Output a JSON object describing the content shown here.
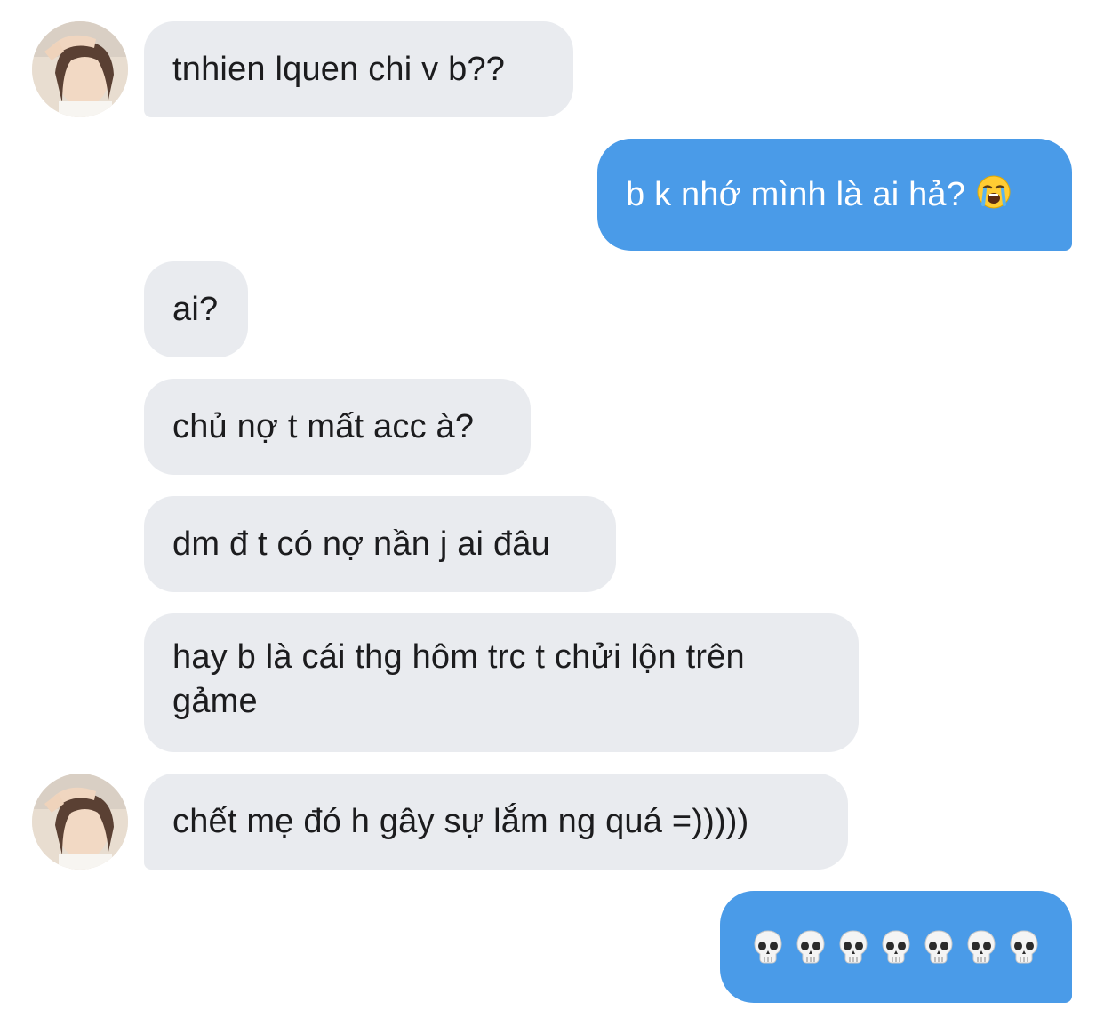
{
  "messages": [
    {
      "id": "m1",
      "from": "them",
      "text": "tnhien lquen chi v b??"
    },
    {
      "id": "m2",
      "from": "me",
      "text": "b k nhớ mình là ai hả?",
      "emoji": "loudly-crying-face"
    },
    {
      "id": "m3",
      "from": "them",
      "text": "ai?"
    },
    {
      "id": "m4",
      "from": "them",
      "text": "chủ nợ t mất acc à?"
    },
    {
      "id": "m5",
      "from": "them",
      "text": "dm đ t có nợ nần j ai đâu"
    },
    {
      "id": "m6",
      "from": "them",
      "text": "hay b là cái thg hôm trc t chửi lộn trên gảme"
    },
    {
      "id": "m7",
      "from": "them",
      "text": "chết mẹ đó h gây sự lắm ng quá =)))))"
    },
    {
      "id": "m8",
      "from": "me",
      "emoji": "skull",
      "emoji_count": 7
    }
  ],
  "colors": {
    "incoming_bubble": "#e9ebef",
    "outgoing_bubble": "#4a9be8",
    "incoming_text": "#1c1c1e",
    "outgoing_text": "#ffffff"
  },
  "icons": [
    "contact-avatar",
    "loudly-crying-face-emoji",
    "skull-emoji"
  ]
}
